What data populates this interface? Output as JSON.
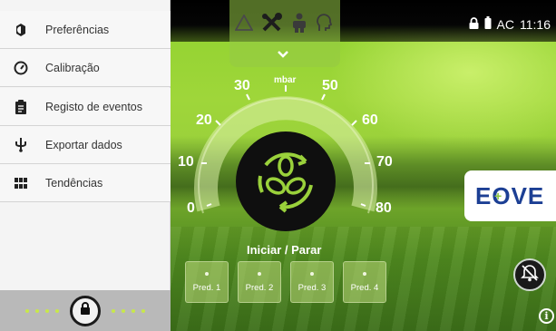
{
  "sidebar": {
    "items": [
      {
        "label": "Preferências",
        "icon": "settings-icon"
      },
      {
        "label": "Calibração",
        "icon": "gauge-icon"
      },
      {
        "label": "Registo de eventos",
        "icon": "clipboard-icon"
      },
      {
        "label": "Exportar dados",
        "icon": "usb-icon"
      },
      {
        "label": "Tendências",
        "icon": "trends-icon"
      }
    ],
    "footer": {
      "lock_icon": "lock-icon"
    }
  },
  "status": {
    "lock_icon": "lock-icon",
    "battery_icon": "battery-icon",
    "power_label": "AC",
    "time": "11:16"
  },
  "top_tabs": {
    "icons": [
      "warning-icon",
      "tools-icon",
      "patient-icon",
      "head-icon"
    ],
    "expand_icon": "chevron-down-icon"
  },
  "gauge": {
    "unit": "mbar",
    "ticks": [
      "0",
      "10",
      "20",
      "30",
      "50",
      "60",
      "70",
      "80"
    ],
    "min": 0,
    "max": 80
  },
  "controls": {
    "start_stop_label": "Iniciar / Parar",
    "presets": [
      "Pred. 1",
      "Pred. 2",
      "Pred. 3",
      "Pred. 4"
    ]
  },
  "brand": {
    "logo_text": "EOVE",
    "logo_color": "#1c3f94",
    "accent": "#8cc63f"
  },
  "buttons": {
    "alarm_icon": "alarm-bell-off-icon",
    "info_icon": "info-icon"
  }
}
